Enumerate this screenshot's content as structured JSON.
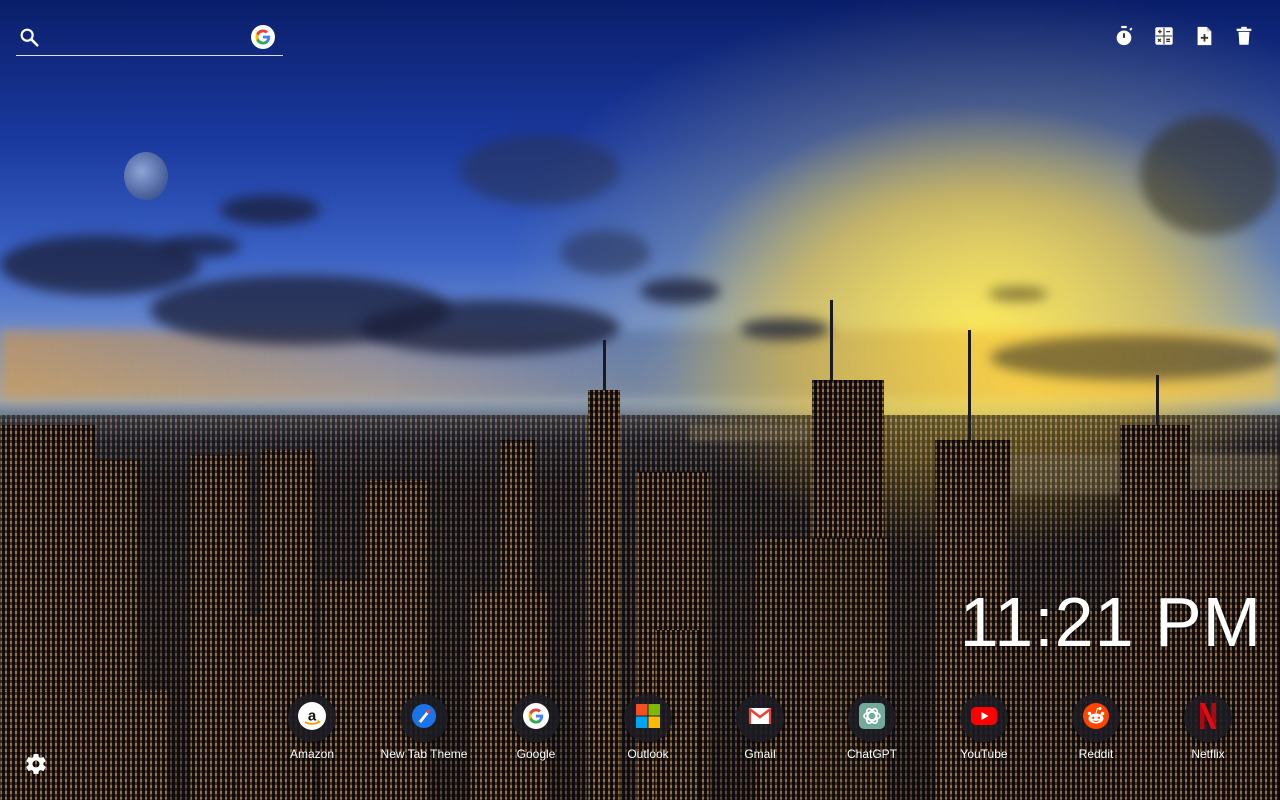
{
  "search": {
    "placeholder": "",
    "engine_icon": "google-g-icon"
  },
  "toolbar": [
    {
      "name": "timer",
      "icon": "stopwatch-icon"
    },
    {
      "name": "calculator",
      "icon": "calculator-icon"
    },
    {
      "name": "new-note",
      "icon": "note-add-icon"
    },
    {
      "name": "delete",
      "icon": "trash-icon"
    }
  ],
  "clock": {
    "time": "11:21 PM"
  },
  "shortcuts": [
    {
      "label": "Amazon",
      "icon": "amazon-icon"
    },
    {
      "label": "New Tab Theme",
      "icon": "new-tab-theme-icon"
    },
    {
      "label": "Google",
      "icon": "google-icon"
    },
    {
      "label": "Outlook",
      "icon": "microsoft-icon"
    },
    {
      "label": "Gmail",
      "icon": "gmail-icon"
    },
    {
      "label": "ChatGPT",
      "icon": "chatgpt-icon"
    },
    {
      "label": "YouTube",
      "icon": "youtube-icon"
    },
    {
      "label": "Reddit",
      "icon": "reddit-icon"
    },
    {
      "label": "Netflix",
      "icon": "netflix-icon"
    }
  ],
  "settings": {
    "icon": "gear-icon"
  },
  "colors": {
    "google_blue": "#4285F4",
    "google_red": "#EA4335",
    "google_yellow": "#FBBC05",
    "google_green": "#34A853",
    "youtube_red": "#FF0000",
    "reddit_orange": "#FF4500",
    "netflix_red": "#E50914",
    "amazon_orange": "#FF9900"
  }
}
